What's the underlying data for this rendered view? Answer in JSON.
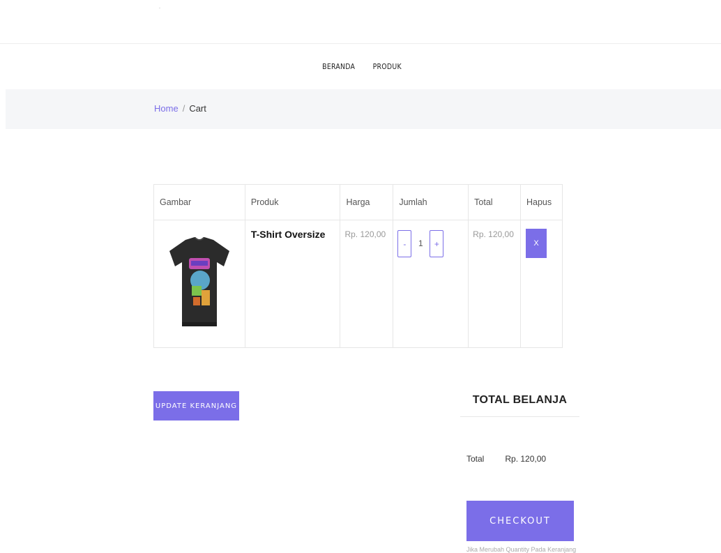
{
  "nav": {
    "items": [
      {
        "label": "BERANDA"
      },
      {
        "label": "PRODUK"
      }
    ]
  },
  "breadcrumb": {
    "home": "Home",
    "separator": "/",
    "current": "Cart"
  },
  "cart": {
    "headers": [
      "Gambar",
      "Produk",
      "Harga",
      "Jumlah",
      "Total",
      "Hapus"
    ],
    "rows": [
      {
        "image": "tshirt-image",
        "product": "T-Shirt Oversize",
        "price": "Rp. 120,00",
        "qty": "1",
        "total": "Rp. 120,00",
        "delete_label": "X"
      }
    ],
    "minus_label": "-",
    "plus_label": "+"
  },
  "actions": {
    "update_label": "UPDATE KERANJANG"
  },
  "summary": {
    "title": "TOTAL BELANJA",
    "total_label": "Total",
    "total_value": "Rp. 120,00",
    "checkout_label": "CHECKOUT",
    "note": "Jika Merubah Quantity Pada Keranjang"
  },
  "colors": {
    "accent": "#7b6ee8",
    "breadcrumb_bg": "#f5f6f8"
  }
}
